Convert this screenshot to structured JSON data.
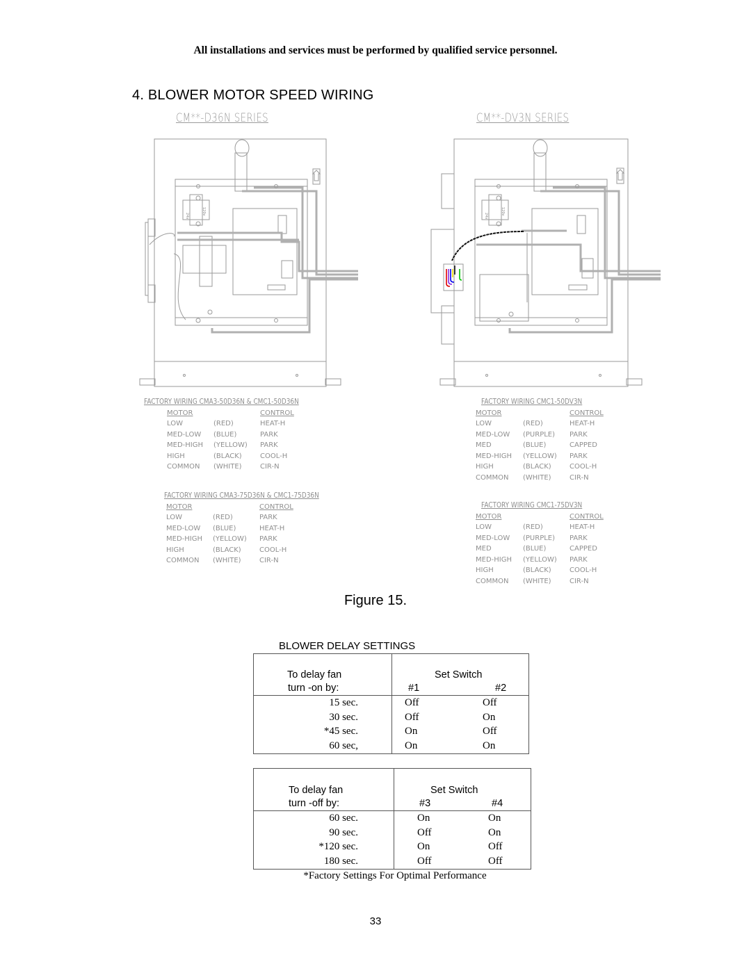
{
  "notice": "All installations and services must be performed by qualified service personnel.",
  "section_title": "4.  BLOWER MOTOR SPEED WIRING",
  "diagrams": [
    {
      "series_label": "CM**-D36N SERIES",
      "transformer_labels": [
        "24v",
        "120v"
      ],
      "wiring_tables": [
        {
          "title": "FACTORY WIRING CMA3-50D36N & CMC1-50D36N",
          "headers": [
            "MOTOR",
            "",
            "CONTROL"
          ],
          "rows": [
            [
              "LOW",
              "(RED)",
              "HEAT-H"
            ],
            [
              "MED-LOW",
              "(BLUE)",
              "PARK"
            ],
            [
              "MED-HIGH",
              "(YELLOW)",
              "PARK"
            ],
            [
              "HIGH",
              "(BLACK)",
              "COOL-H"
            ],
            [
              "COMMON",
              "(WHITE)",
              "CIR-N"
            ]
          ]
        },
        {
          "title": "FACTORY WIRING CMA3-75D36N & CMC1-75D36N",
          "headers": [
            "MOTOR",
            "",
            "CONTROL"
          ],
          "rows": [
            [
              "LOW",
              "(RED)",
              "PARK"
            ],
            [
              "MED-LOW",
              "(BLUE)",
              "HEAT-H"
            ],
            [
              "MED-HIGH",
              "(YELLOW)",
              "PARK"
            ],
            [
              "HIGH",
              "(BLACK)",
              "COOL-H"
            ],
            [
              "COMMON",
              "(WHITE)",
              "CIR-N"
            ]
          ]
        }
      ]
    },
    {
      "series_label": "CM**-DV3N SERIES",
      "transformer_labels": [
        "24v",
        "120v"
      ],
      "wire_colors": [
        "#e00000",
        "#8a2be2",
        "#0000ee",
        "#f0e000",
        "#111111",
        "#00c000"
      ],
      "wiring_tables": [
        {
          "title": "FACTORY WIRING CMC1-50DV3N",
          "headers": [
            "MOTOR",
            "",
            "CONTROL"
          ],
          "rows": [
            [
              "LOW",
              "(RED)",
              "HEAT-H"
            ],
            [
              "MED-LOW",
              "(PURPLE)",
              "PARK"
            ],
            [
              "MED",
              "(BLUE)",
              "CAPPED"
            ],
            [
              "MED-HIGH",
              "(YELLOW)",
              "PARK"
            ],
            [
              "HIGH",
              "(BLACK)",
              "COOL-H"
            ],
            [
              "COMMON",
              "(WHITE)",
              "CIR-N"
            ]
          ]
        },
        {
          "title": "FACTORY WIRING CMC1-75DV3N",
          "headers": [
            "MOTOR",
            "",
            "CONTROL"
          ],
          "rows": [
            [
              "LOW",
              "(RED)",
              "HEAT-H"
            ],
            [
              "MED-LOW",
              "(PURPLE)",
              "PARK"
            ],
            [
              "MED",
              "(BLUE)",
              "CAPPED"
            ],
            [
              "MED-HIGH",
              "(YELLOW)",
              "PARK"
            ],
            [
              "HIGH",
              "(BLACK)",
              "COOL-H"
            ],
            [
              "COMMON",
              "(WHITE)",
              "CIR-N"
            ]
          ]
        }
      ]
    }
  ],
  "figure_caption": "Figure 15.",
  "delay_settings": {
    "title": "BLOWER DELAY SETTINGS",
    "tables": [
      {
        "label_line1": "To delay fan",
        "label_line2": "turn -on by:",
        "switch_header": "Set Switch",
        "switch_a": "#1",
        "switch_b": "#2",
        "rows": [
          [
            "15 sec.",
            "Off",
            "Off"
          ],
          [
            "30 sec.",
            "Off",
            "On"
          ],
          [
            "*45 sec.",
            "On",
            "Off"
          ],
          [
            "60 sec,",
            "On",
            "On"
          ]
        ]
      },
      {
        "label_line1": "To delay fan",
        "label_line2": "turn -off by:",
        "switch_header": "Set Switch",
        "switch_a": "#3",
        "switch_b": "#4",
        "rows": [
          [
            "60 sec.",
            "On",
            "On"
          ],
          [
            "90 sec.",
            "Off",
            "On"
          ],
          [
            "*120 sec.",
            "On",
            "Off"
          ],
          [
            "180 sec.",
            "Off",
            "Off"
          ]
        ]
      }
    ],
    "footnote": "*Factory Settings For Optimal Performance"
  },
  "page_number": "33"
}
